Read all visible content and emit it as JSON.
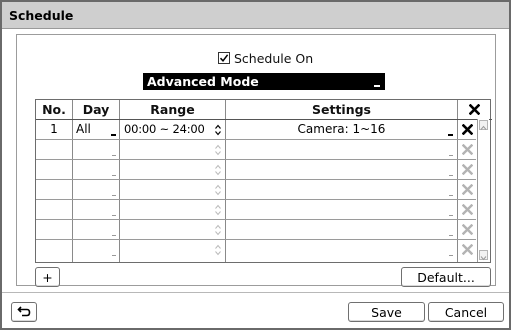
{
  "dialog": {
    "title": "Schedule"
  },
  "schedule_on": {
    "label": "Schedule On",
    "checked": true
  },
  "mode": {
    "selected": "Advanced Mode"
  },
  "table": {
    "headers": [
      "No.",
      "Day",
      "Range",
      "Settings"
    ],
    "delete_header_icon": "close-x-icon",
    "rows": [
      {
        "no": "1",
        "day": "All",
        "range": "00:00 ~ 24:00",
        "settings": "Camera: 1~16"
      }
    ],
    "empty_rows": 6
  },
  "buttons": {
    "add": "+",
    "default": "Default...",
    "save": "Save",
    "cancel": "Cancel",
    "back_icon": "return-arrow-icon"
  }
}
